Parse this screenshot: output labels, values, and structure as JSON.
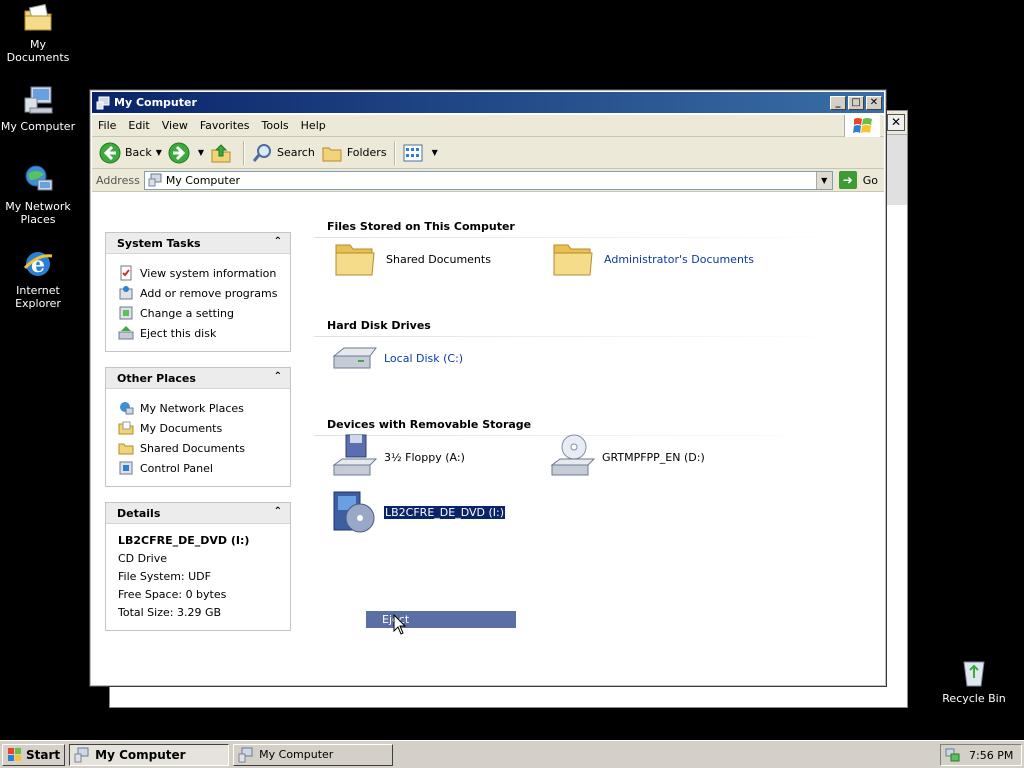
{
  "desktop": {
    "icons": [
      {
        "label": "My Documents"
      },
      {
        "label": "My Computer"
      },
      {
        "label": "My Network Places"
      },
      {
        "label": "Internet Explorer"
      },
      {
        "label": "Recycle Bin"
      }
    ]
  },
  "window": {
    "title": "My Computer",
    "controls": {
      "minimize": "_",
      "maximize": "□",
      "close": "✕"
    }
  },
  "menubar": {
    "items": [
      "File",
      "Edit",
      "View",
      "Favorites",
      "Tools",
      "Help"
    ]
  },
  "toolbar": {
    "back_label": "Back",
    "search_label": "Search",
    "folders_label": "Folders"
  },
  "address": {
    "label": "Address",
    "value": "My Computer",
    "go_label": "Go"
  },
  "sidebar": {
    "system_tasks": {
      "title": "System Tasks",
      "items": [
        "View system information",
        "Add or remove programs",
        "Change a setting",
        "Eject this disk"
      ]
    },
    "other_places": {
      "title": "Other Places",
      "items": [
        "My Network Places",
        "My Documents",
        "Shared Documents",
        "Control Panel"
      ]
    },
    "details": {
      "title": "Details",
      "name": "LB2CFRE_DE_DVD (I:)",
      "type": "CD Drive",
      "file_system": "File System: UDF",
      "free_space": "Free Space: 0 bytes",
      "total_size": "Total Size: 3.29 GB"
    }
  },
  "main": {
    "groups": [
      {
        "title": "Files Stored on This Computer",
        "items": [
          "Shared Documents",
          "Administrator's Documents"
        ]
      },
      {
        "title": "Hard Disk Drives",
        "items": [
          "Local Disk (C:)"
        ]
      },
      {
        "title": "Devices with Removable Storage",
        "items": [
          "3½ Floppy (A:)",
          "GRTMPFPP_EN (D:)",
          "LB2CFRE_DE_DVD (I:)"
        ]
      }
    ]
  },
  "context_menu": {
    "item": "Eject"
  },
  "taskbar": {
    "start_label": "Start",
    "buttons": [
      "My Computer",
      "My Computer"
    ],
    "clock": "7:56 PM"
  },
  "colors": {
    "titlebar": "#0a246a",
    "link": "#0b3aa4",
    "selection": "#0a246a"
  }
}
